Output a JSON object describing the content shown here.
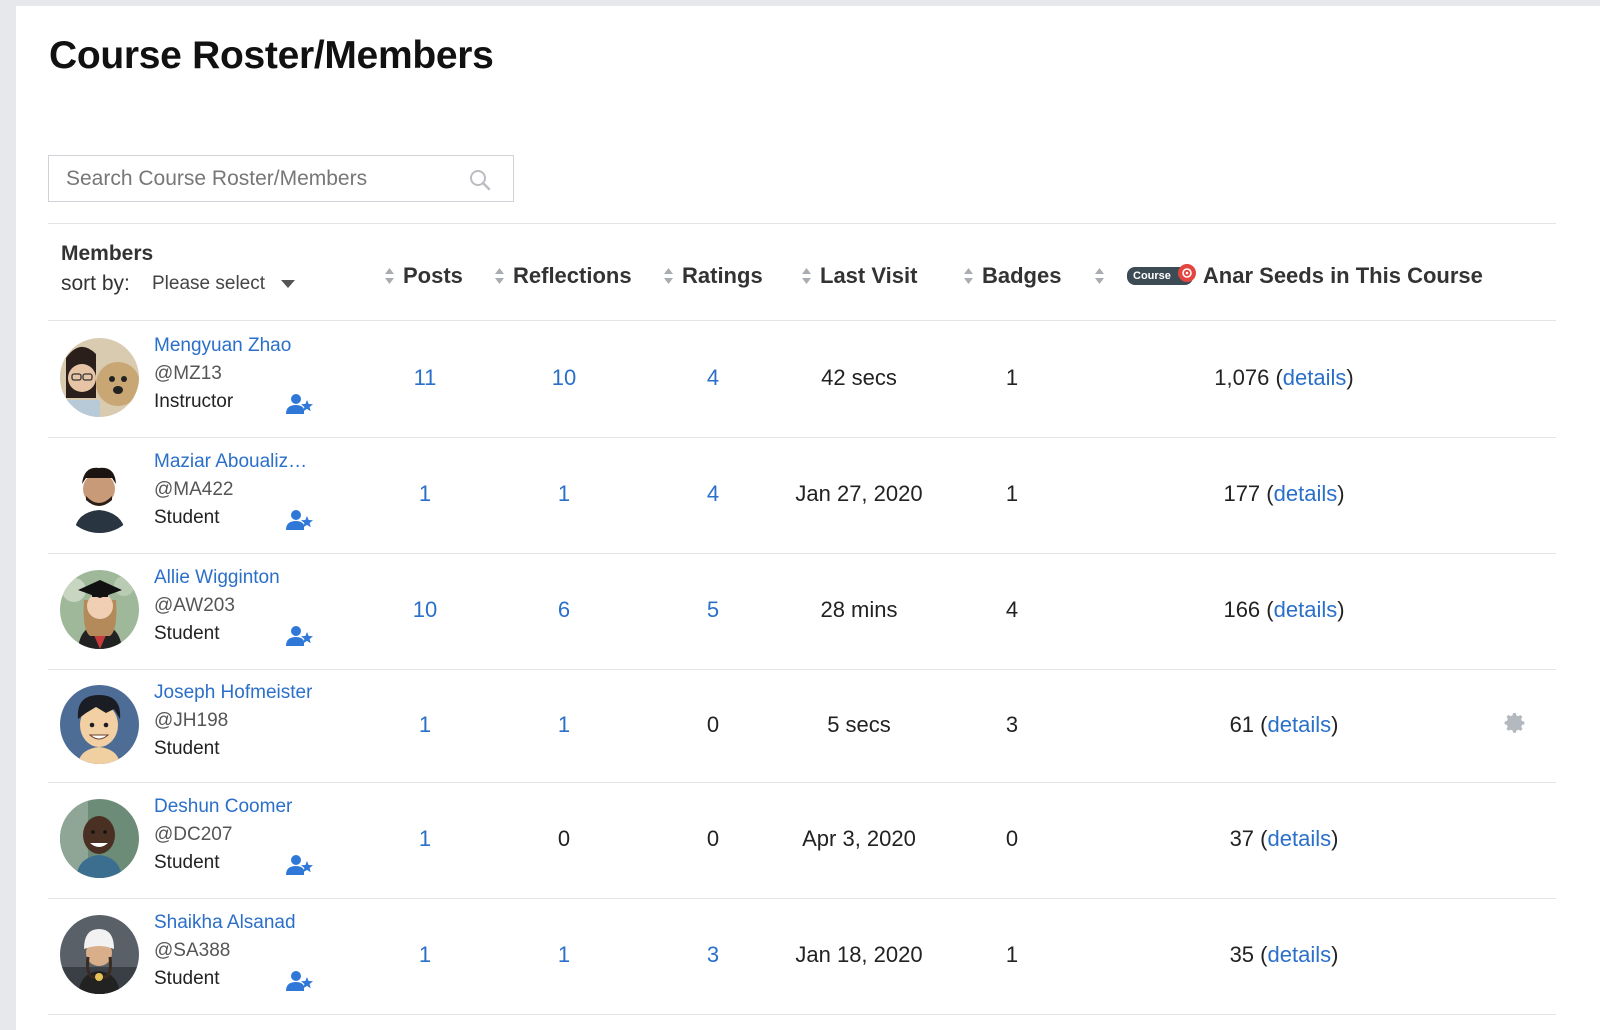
{
  "page": {
    "title": "Course Roster/Members"
  },
  "search": {
    "placeholder": "Search Course Roster/Members"
  },
  "table": {
    "members_header": "Members",
    "sort_by_label": "sort by:",
    "sort_select_value": "Please select",
    "columns": {
      "posts": "Posts",
      "reflections": "Reflections",
      "ratings": "Ratings",
      "last_visit": "Last Visit",
      "badges": "Badges",
      "course_badge": "Course",
      "seeds": "Anar Seeds in This Course"
    },
    "details_label": "details",
    "rows": [
      {
        "name": "Mengyuan Zhao",
        "handle": "@MZ13",
        "role": "Instructor",
        "posts": "11",
        "reflections": "10",
        "ratings": "4",
        "last_visit": "42 secs",
        "badges": "1",
        "seeds": "1,076",
        "posts_link": true,
        "reflections_link": true,
        "ratings_link": true,
        "add_icon": true,
        "gear_icon": false
      },
      {
        "name": "Maziar Aboualiz…",
        "handle": "@MA422",
        "role": "Student",
        "posts": "1",
        "reflections": "1",
        "ratings": "4",
        "last_visit": "Jan 27, 2020",
        "badges": "1",
        "seeds": "177",
        "posts_link": true,
        "reflections_link": true,
        "ratings_link": true,
        "add_icon": true,
        "gear_icon": false
      },
      {
        "name": "Allie Wigginton",
        "handle": "@AW203",
        "role": "Student",
        "posts": "10",
        "reflections": "6",
        "ratings": "5",
        "last_visit": "28 mins",
        "badges": "4",
        "seeds": "166",
        "posts_link": true,
        "reflections_link": true,
        "ratings_link": true,
        "add_icon": true,
        "gear_icon": false
      },
      {
        "name": "Joseph Hofmeister",
        "handle": "@JH198",
        "role": "Student",
        "posts": "1",
        "reflections": "1",
        "ratings": "0",
        "last_visit": "5 secs",
        "badges": "3",
        "seeds": "61",
        "posts_link": true,
        "reflections_link": true,
        "ratings_link": false,
        "add_icon": false,
        "gear_icon": true
      },
      {
        "name": "Deshun Coomer",
        "handle": "@DC207",
        "role": "Student",
        "posts": "1",
        "reflections": "0",
        "ratings": "0",
        "last_visit": "Apr 3, 2020",
        "badges": "0",
        "seeds": "37",
        "posts_link": true,
        "reflections_link": false,
        "ratings_link": false,
        "add_icon": true,
        "gear_icon": false
      },
      {
        "name": "Shaikha Alsanad",
        "handle": "@SA388",
        "role": "Student",
        "posts": "1",
        "reflections": "1",
        "ratings": "3",
        "last_visit": "Jan 18, 2020",
        "badges": "1",
        "seeds": "35",
        "posts_link": true,
        "reflections_link": true,
        "ratings_link": true,
        "add_icon": true,
        "gear_icon": false
      }
    ]
  },
  "icons": {
    "search": "search-icon",
    "sort": "sort-arrows-icon",
    "add_member": "user-plus-star-icon",
    "settings": "gear-icon",
    "seed": "anar-seed-icon"
  },
  "colors": {
    "link": "#2a6fc9",
    "icon_blue": "#2f78d8",
    "badge_dark": "#3d4b55",
    "seed_red": "#e2463f"
  }
}
